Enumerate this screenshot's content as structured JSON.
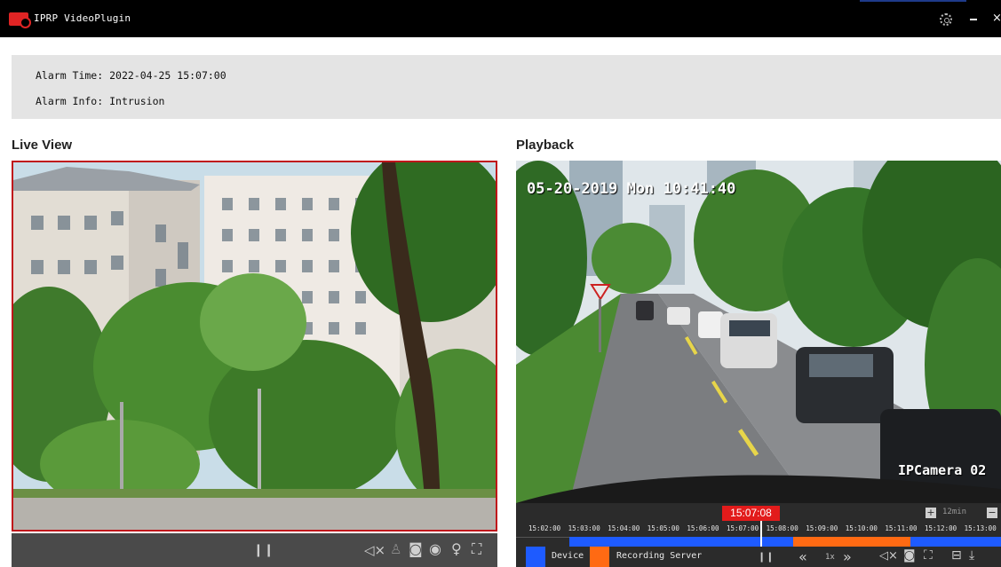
{
  "window": {
    "title": "IPRP VideoPlugin",
    "icons": [
      "app-icon",
      "gear-icon",
      "minimize-icon",
      "close-icon"
    ],
    "close_glyph": "×"
  },
  "alarm": {
    "time_label": "Alarm Time:",
    "time_value": "2022-04-25 15:07:00",
    "info_label": "Alarm Info:",
    "info_value": "Intrusion"
  },
  "live_view": {
    "title": "Live View",
    "controls": [
      "pause-icon",
      "mute-icon",
      "mic-icon",
      "snapshot-icon",
      "record-icon",
      "person-icon",
      "fullscreen-icon"
    ]
  },
  "playback": {
    "title": "Playback",
    "osd_timestamp": "05-20-2019 Mon 10:41:40",
    "osd_camera": "IPCamera 02",
    "current_time": "15:07:08",
    "zoom_level": "12min",
    "zoom_in": "+",
    "zoom_out": "−",
    "ticks": [
      "15:02:00",
      "15:03:00",
      "15:04:00",
      "15:05:00",
      "15:06:00",
      "15:07:00",
      "15:08:00",
      "15:09:00",
      "15:10:00",
      "15:11:00",
      "15:12:00",
      "15:13:00"
    ],
    "legend": [
      {
        "label": "Device",
        "color": "#1e5bff"
      },
      {
        "label": "Recording Server",
        "color": "#ff6a13"
      }
    ],
    "speed": "1x",
    "controls": [
      "pause-icon",
      "rewind-icon",
      "forward-icon",
      "mute-icon",
      "snapshot-icon",
      "fullscreen-icon",
      "clip-icon",
      "download-icon"
    ]
  },
  "colors": {
    "accent_red": "#c0161b",
    "device_blue": "#1e5bff",
    "server_orange": "#ff6a13"
  }
}
